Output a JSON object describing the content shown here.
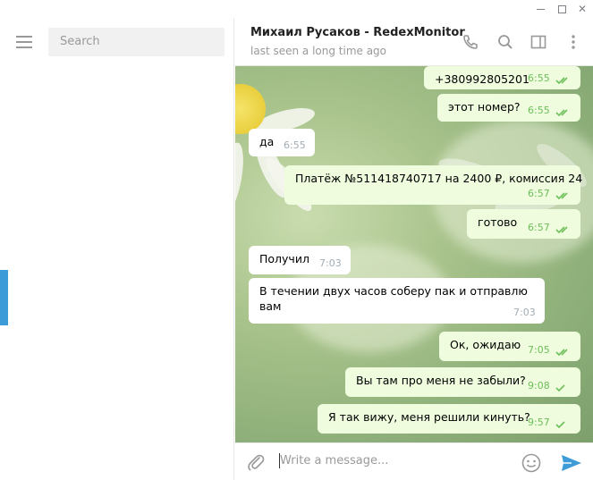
{
  "window": {
    "minimize": "minimize",
    "maximize": "maximize",
    "close": "close"
  },
  "sidebar": {
    "search_placeholder": "Search"
  },
  "chat": {
    "peer_name": "Михаил Русаков - RedexMonitor",
    "peer_status": "last seen a long time ago",
    "messages": [
      {
        "text": "+380992805201",
        "time": "6:55",
        "direction": "out",
        "status": "read"
      },
      {
        "text": "этот номер?",
        "time": "6:55",
        "direction": "out",
        "status": "read"
      },
      {
        "text": "да",
        "time": "6:55",
        "direction": "in"
      },
      {
        "text": "Платёж №511418740717 на 2400 ₽, комиссия 24",
        "time": "6:57",
        "direction": "out",
        "status": "read"
      },
      {
        "text": "готово",
        "time": "6:57",
        "direction": "out",
        "status": "read"
      },
      {
        "text": "Получил",
        "time": "7:03",
        "direction": "in"
      },
      {
        "text_line1": "В течении двух часов соберу пак и отправлю",
        "text_line2": "вам",
        "time": "7:03",
        "direction": "in"
      },
      {
        "text": "Ок, ожидаю",
        "time": "7:05",
        "direction": "out",
        "status": "read"
      },
      {
        "text": "Вы там про меня не забыли?",
        "time": "9:08",
        "direction": "out",
        "status": "sent"
      },
      {
        "text": "Я так вижу, меня решили кинуть?",
        "time": "9:57",
        "direction": "out",
        "status": "sent"
      }
    ]
  },
  "composer": {
    "placeholder": "Write a message..."
  },
  "colors": {
    "accent": "#3d9bd8",
    "outgoing_bubble": "#effdde",
    "check": "#6dbf5a",
    "send": "#3d9bd8"
  },
  "icons": [
    "menu-icon",
    "phone-icon",
    "search-icon",
    "sidebar-toggle-icon",
    "more-vertical-icon",
    "attach-icon",
    "emoji-icon",
    "send-icon"
  ]
}
